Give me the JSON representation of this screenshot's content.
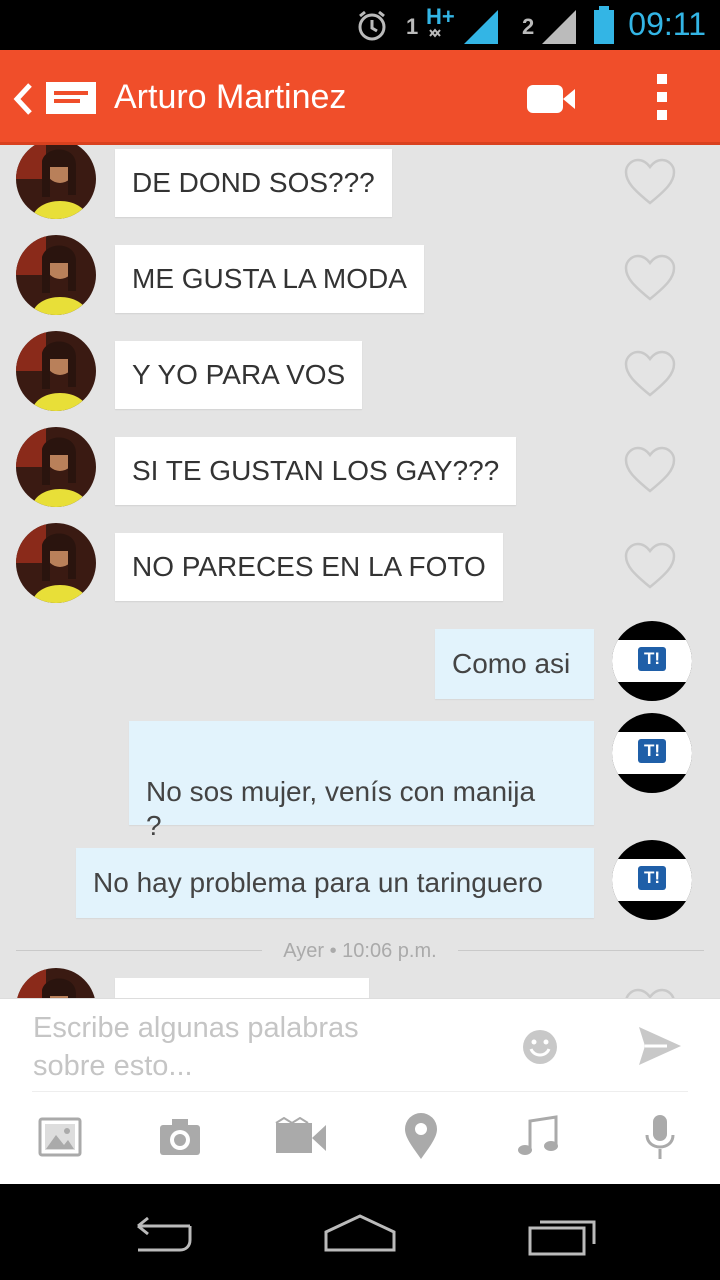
{
  "status_bar": {
    "time": "09:11",
    "sim1": "1",
    "sim1_network": "H+",
    "sim2": "2",
    "icons": [
      "alarm-icon",
      "signal-icon",
      "battery-icon"
    ]
  },
  "header": {
    "title": "Arturo Martinez",
    "accent_color": "#f04e2a",
    "icons": [
      "back-icon",
      "message-icon",
      "video-call-icon",
      "overflow-menu-icon"
    ]
  },
  "incoming_messages": [
    {
      "text": "DE DOND SOS???"
    },
    {
      "text": "ME GUSTA LA MODA"
    },
    {
      "text": "Y YO PARA VOS"
    },
    {
      "text": "SI TE GUSTAN LOS GAY???"
    },
    {
      "text": "NO PARECES EN LA FOTO"
    }
  ],
  "outgoing_messages": [
    {
      "text": "Como asi"
    },
    {
      "text": "No sos mujer, venís con manija\n?"
    },
    {
      "text": "No hay problema para un taringuero"
    }
  ],
  "outgoing_avatar_logo": "T!",
  "date_separator": "Ayer • 10:06 p.m.",
  "composer": {
    "placeholder": "Escribe algunas palabras\nsobre esto...",
    "icons": [
      "emoji-icon",
      "send-icon",
      "gallery-icon",
      "camera-icon",
      "video-icon",
      "location-icon",
      "music-icon",
      "microphone-icon"
    ]
  },
  "navigation": {
    "icons": [
      "back-nav-icon",
      "home-icon",
      "recents-icon"
    ]
  }
}
